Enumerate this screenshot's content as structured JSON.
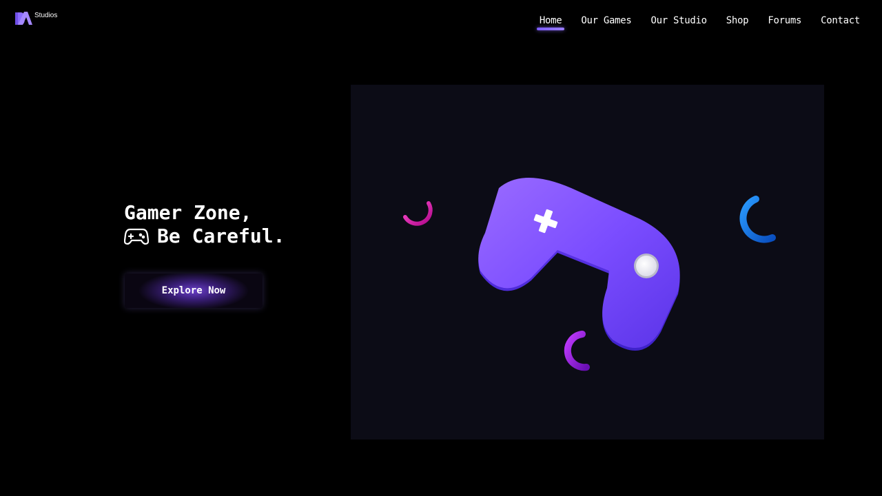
{
  "brand": {
    "logo_icon": "da-logo-icon",
    "name": "Studios",
    "color": "#8b6cff"
  },
  "nav": {
    "items": [
      {
        "label": "Home",
        "active": true
      },
      {
        "label": "Our Games",
        "active": false
      },
      {
        "label": "Our Studio",
        "active": false
      },
      {
        "label": "Shop",
        "active": false
      },
      {
        "label": "Forums",
        "active": false
      },
      {
        "label": "Contact",
        "active": false
      }
    ],
    "active_underline_color": "#7c5cff"
  },
  "hero": {
    "line1": "Gamer Zone,",
    "line2": "Be Careful.",
    "line2_icon": "gamepad-icon",
    "cta_label": "Explore Now"
  },
  "illustration": {
    "main_icon": "gamepad-3d-illustration",
    "controller_color": "#7b4dff",
    "panel_color": "#0c0c16",
    "ring_colors": {
      "pink": "#e61bb0",
      "blue": "#1a7cf0",
      "purple": "#9b1be6"
    }
  }
}
